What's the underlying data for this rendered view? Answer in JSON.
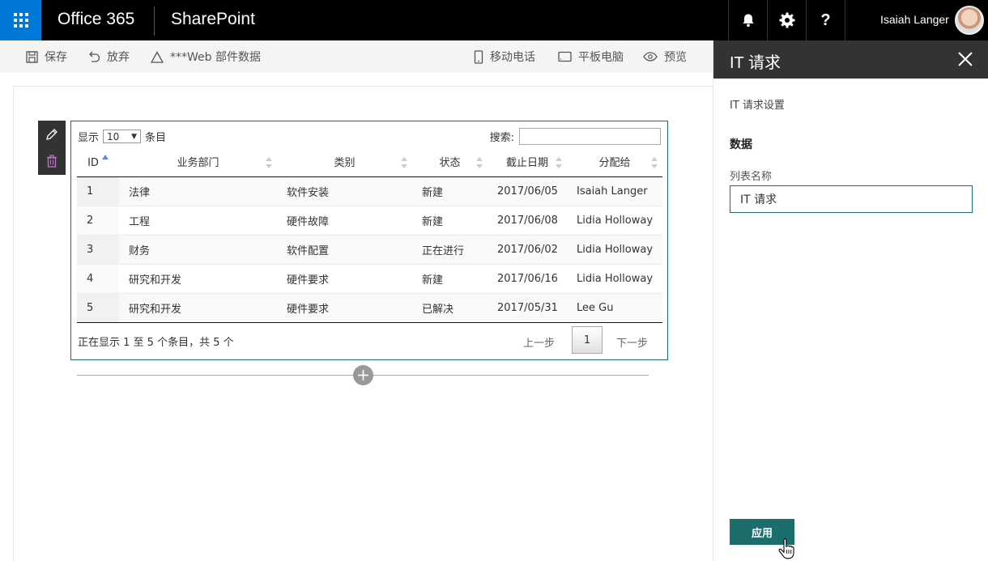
{
  "suitebar": {
    "brand": "Office 365",
    "app": "SharePoint",
    "user_name": "Isaiah Langer",
    "icons": [
      "waffle-icon",
      "bell-icon",
      "gear-icon",
      "help-icon"
    ],
    "help_glyph": "?"
  },
  "commandbar": {
    "save": "保存",
    "discard": "放弃",
    "webpart_data": "***Web 部件数据",
    "mobile": "移动电话",
    "tablet": "平板电脑",
    "preview": "预览"
  },
  "webpart": {
    "show_label": "显示",
    "page_length": "10",
    "entries_label": "条目",
    "search_label": "搜索:",
    "columns": [
      "ID",
      "业务部门",
      "类别",
      "状态",
      "截止日期",
      "分配给"
    ],
    "rows": [
      [
        "1",
        "法律",
        "软件安装",
        "新建",
        "2017/06/05",
        "Isaiah Langer"
      ],
      [
        "2",
        "工程",
        "硬件故障",
        "新建",
        "2017/06/08",
        "Lidia Holloway"
      ],
      [
        "3",
        "财务",
        "软件配置",
        "正在进行",
        "2017/06/02",
        "Lidia Holloway"
      ],
      [
        "4",
        "研究和开发",
        "硬件要求",
        "新建",
        "2017/06/16",
        "Lidia Holloway"
      ],
      [
        "5",
        "研究和开发",
        "硬件要求",
        "已解决",
        "2017/05/31",
        "Lee Gu"
      ]
    ],
    "info": "正在显示 1 至 5 个条目，共 5 个",
    "prev": "上一步",
    "page": "1",
    "next": "下一步"
  },
  "pane": {
    "title": "IT 请求",
    "subtitle": "IT 请求设置",
    "group": "数据",
    "list_label": "列表名称",
    "list_value": "IT 请求",
    "apply": "应用"
  },
  "colors": {
    "accent": "#1b6e6c",
    "waffle": "#0078d7",
    "suitebar": "#000000",
    "pane_header": "#333333"
  }
}
